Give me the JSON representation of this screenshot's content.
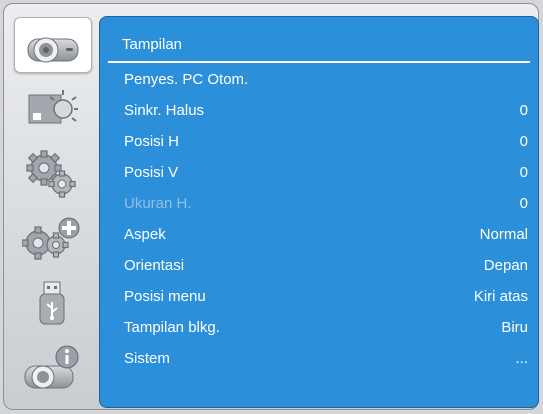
{
  "menu": {
    "title": "Tampilan",
    "items": [
      {
        "label": "Penyes. PC Otom.",
        "value": "",
        "disabled": false
      },
      {
        "label": "Sinkr. Halus",
        "value": "0",
        "disabled": false
      },
      {
        "label": "Posisi H",
        "value": "0",
        "disabled": false
      },
      {
        "label": "Posisi V",
        "value": "0",
        "disabled": false
      },
      {
        "label": "Ukuran H.",
        "value": "0",
        "disabled": true
      },
      {
        "label": "Aspek",
        "value": "Normal",
        "disabled": false
      },
      {
        "label": "Orientasi",
        "value": "Depan",
        "disabled": false
      },
      {
        "label": "Posisi menu",
        "value": "Kiri atas",
        "disabled": false
      },
      {
        "label": "Tampilan blkg.",
        "value": "Biru",
        "disabled": false
      },
      {
        "label": "Sistem",
        "value": "...",
        "disabled": false
      }
    ]
  },
  "sidebar": {
    "items": [
      {
        "icon": "projector-icon",
        "selected": true
      },
      {
        "icon": "brightness-icon",
        "selected": false
      },
      {
        "icon": "gears-icon",
        "selected": false
      },
      {
        "icon": "gears-plus-icon",
        "selected": false
      },
      {
        "icon": "usb-icon",
        "selected": false
      },
      {
        "icon": "projector-info-icon",
        "selected": false
      }
    ]
  },
  "colors": {
    "panel": "#2b8fd9",
    "text": "#ffffff",
    "disabled_text": "#93bfe6",
    "icon_gray": "#9a9ea5"
  }
}
